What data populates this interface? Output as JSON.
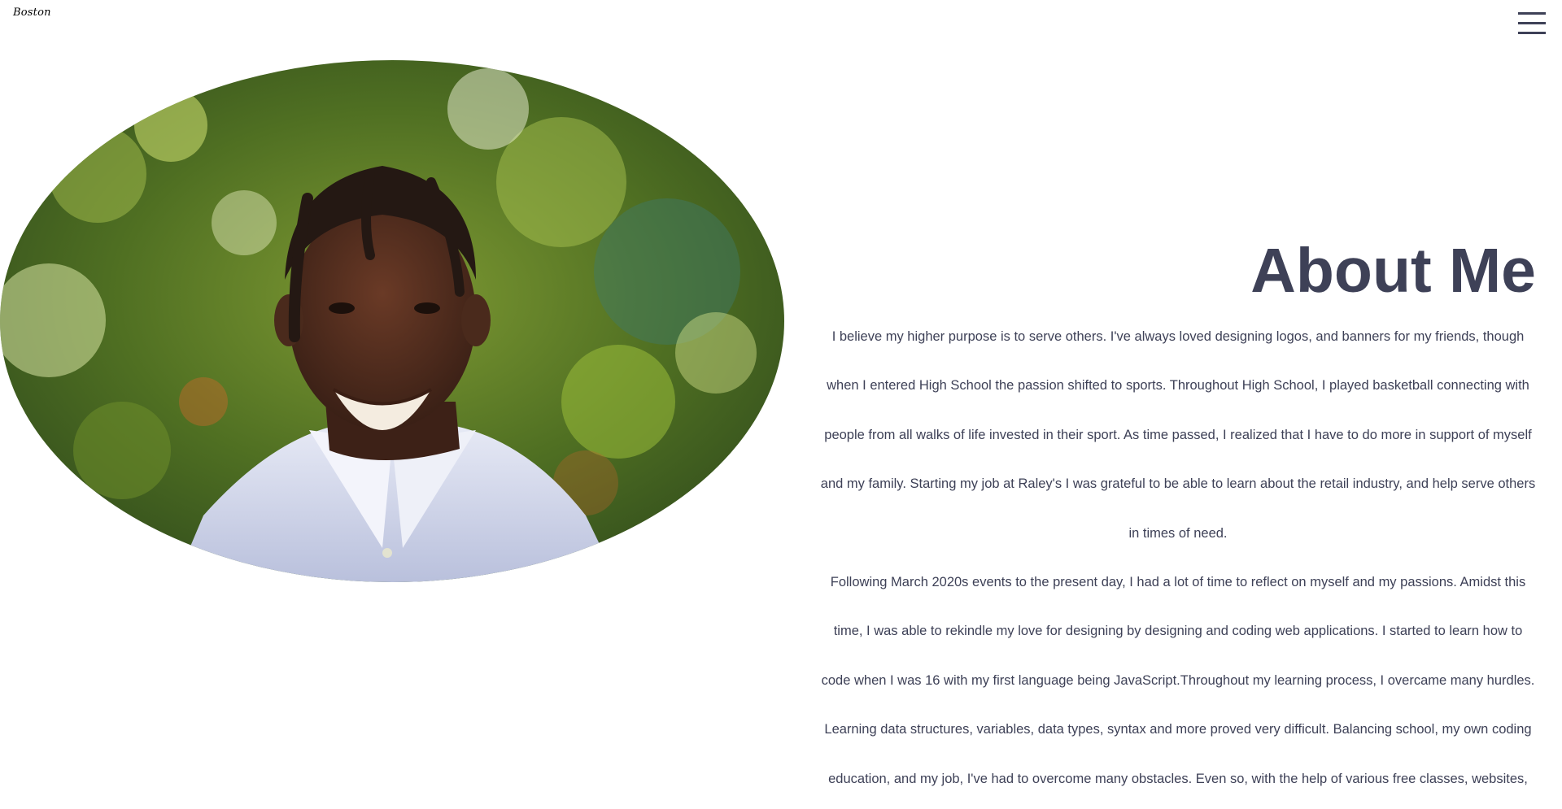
{
  "header": {
    "brand": "Boston",
    "menu_icon": "hamburger-menu-icon"
  },
  "hero": {
    "photo": {
      "description_icon": "portrait-photo",
      "colors": {
        "foliage_dark": "#2f4a1c",
        "foliage_mid": "#6f8f2c",
        "foliage_light": "#c6d86a",
        "shirt": "#c9cfe4",
        "skin": "#4a2a1c"
      }
    }
  },
  "about": {
    "title": "About Me",
    "paragraphs": [
      "I believe my higher purpose is to serve others. I've always loved designing logos, and banners for my friends, though when I entered High School the passion shifted to sports. Throughout High School, I played basketball connecting with people from all walks of life invested in their sport. As time passed, I realized that I have to do more in support of myself and my family. Starting my job at Raley's I was grateful to be able to learn about the retail industry, and help serve others in times of need.",
      "Following March 2020s events to the present day, I had a lot of time to reflect on myself and my passions. Amidst this time, I was able to rekindle my love for designing by designing and coding web applications. I started to learn how to code when I was 16 with my first language being JavaScript.Throughout my learning process, I overcame many hurdles. Learning data structures, variables, data types, syntax and more proved very difficult. Balancing school, my own coding education, and my job, I've had to overcome many obstacles. Even so, with the help of various free classes, websites,"
    ]
  },
  "theme": {
    "text_color": "#3e4157",
    "background": "#ffffff"
  }
}
